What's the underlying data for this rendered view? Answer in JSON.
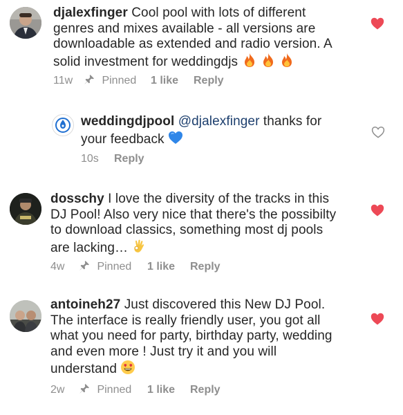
{
  "comments": [
    {
      "username": "djalexfinger",
      "text_lines": [
        " Cool pool with lots of different",
        "genres and mixes available - all versions are",
        "downloadable as extended and radio version. A",
        "solid investment for weddingdjs "
      ],
      "emoji": "fire-fire-fire",
      "time": "11w",
      "pinned_label": "Pinned",
      "likes_label": "1 like",
      "reply_label": "Reply",
      "liked": true,
      "heart_color": "#ed4956"
    },
    {
      "username": "weddingdjpool",
      "mention": "@djalexfinger",
      "text_lines": [
        " thanks for",
        "your feedback "
      ],
      "emoji": "blue-heart",
      "time": "10s",
      "reply_label": "Reply",
      "liked": false,
      "heart_color": "#8e8e8e"
    },
    {
      "username": "dosschy",
      "text_lines": [
        " I love the diversity of the tracks in this",
        "DJ Pool! Also very nice that there's the possibilty",
        "to download classics, something most dj pools",
        "are lacking… "
      ],
      "emoji": "ok-hand",
      "time": "4w",
      "pinned_label": "Pinned",
      "likes_label": "1 like",
      "reply_label": "Reply",
      "liked": true,
      "heart_color": "#ed4956"
    },
    {
      "username": "antoineh27",
      "text_lines": [
        " Just discovered this New DJ Pool.",
        "The interface is really friendly user, you got all",
        "what you need for party, birthday party, wedding",
        "and even more ! Just try it and you will",
        "understand "
      ],
      "emoji": "heart-eyes",
      "time": "2w",
      "pinned_label": "Pinned",
      "likes_label": "1 like",
      "reply_label": "Reply",
      "liked": true,
      "heart_color": "#ed4956"
    }
  ],
  "colors": {
    "text": "#262626",
    "meta": "#8e8e8e",
    "like_red": "#ed4956",
    "mention": "#1d3f6e",
    "brand_blue": "#1f6fd1"
  }
}
